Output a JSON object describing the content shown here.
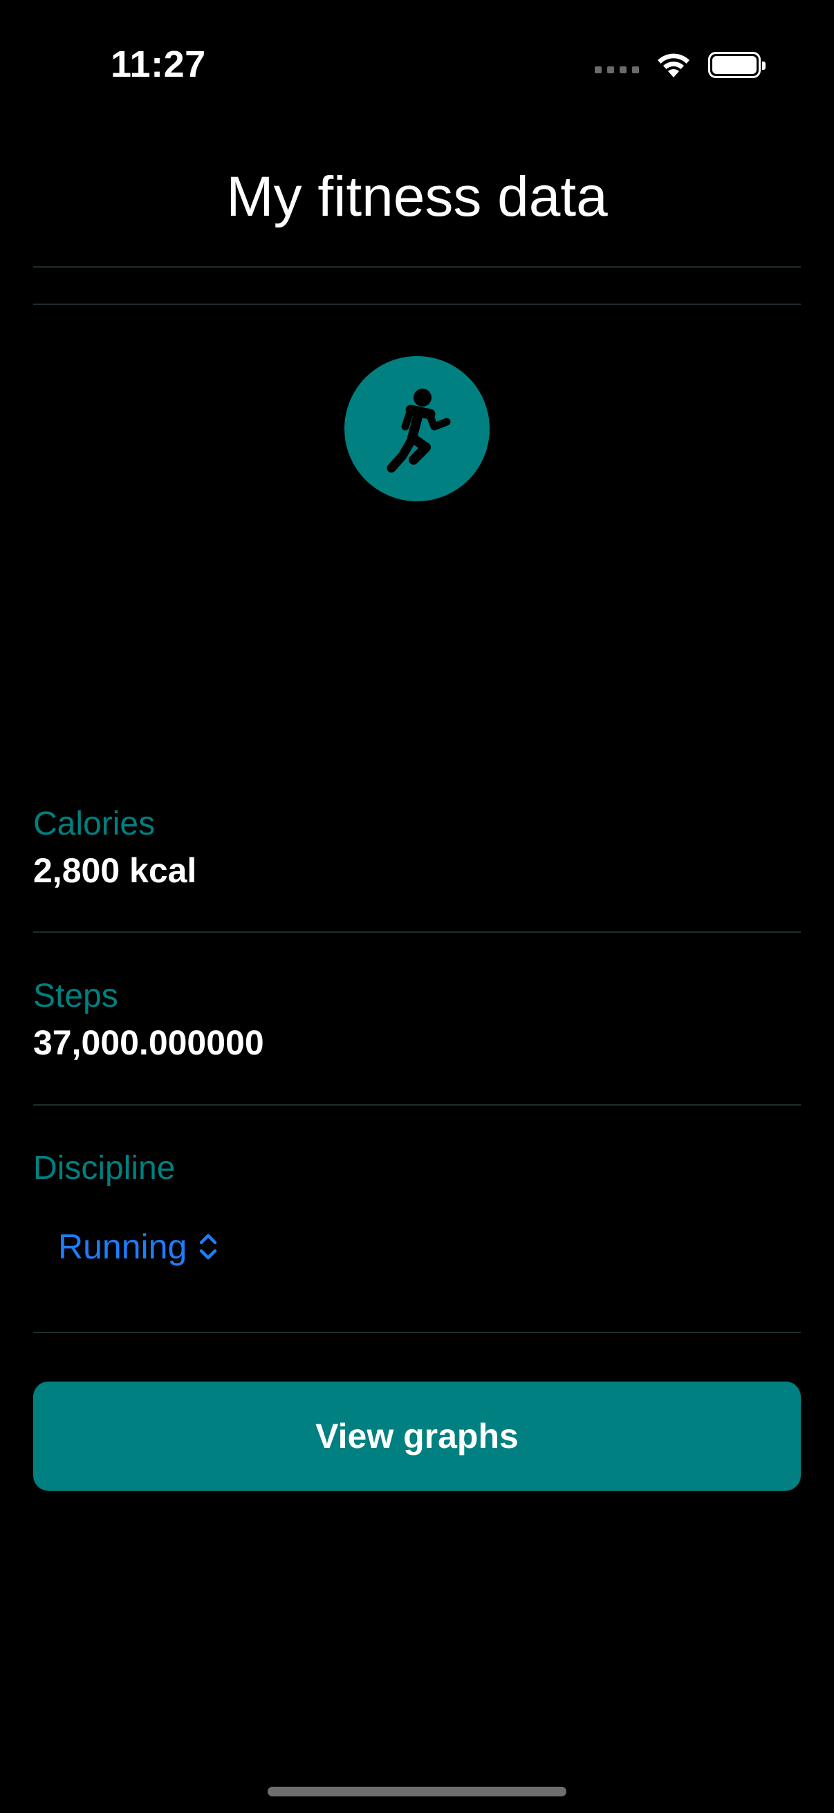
{
  "status_bar": {
    "time": "11:27"
  },
  "header": {
    "title": "My fitness data"
  },
  "activity_icon": "figure-run-icon",
  "fields": {
    "calories": {
      "label": "Calories",
      "value": "2,800 kcal"
    },
    "steps": {
      "label": "Steps",
      "value": "37,000.000000"
    },
    "discipline": {
      "label": "Discipline",
      "selected": "Running"
    }
  },
  "actions": {
    "view_graphs_label": "View graphs"
  },
  "colors": {
    "accent": "#008080",
    "link": "#1e7dfa",
    "background": "#000000",
    "divider": "#1e2e30"
  }
}
